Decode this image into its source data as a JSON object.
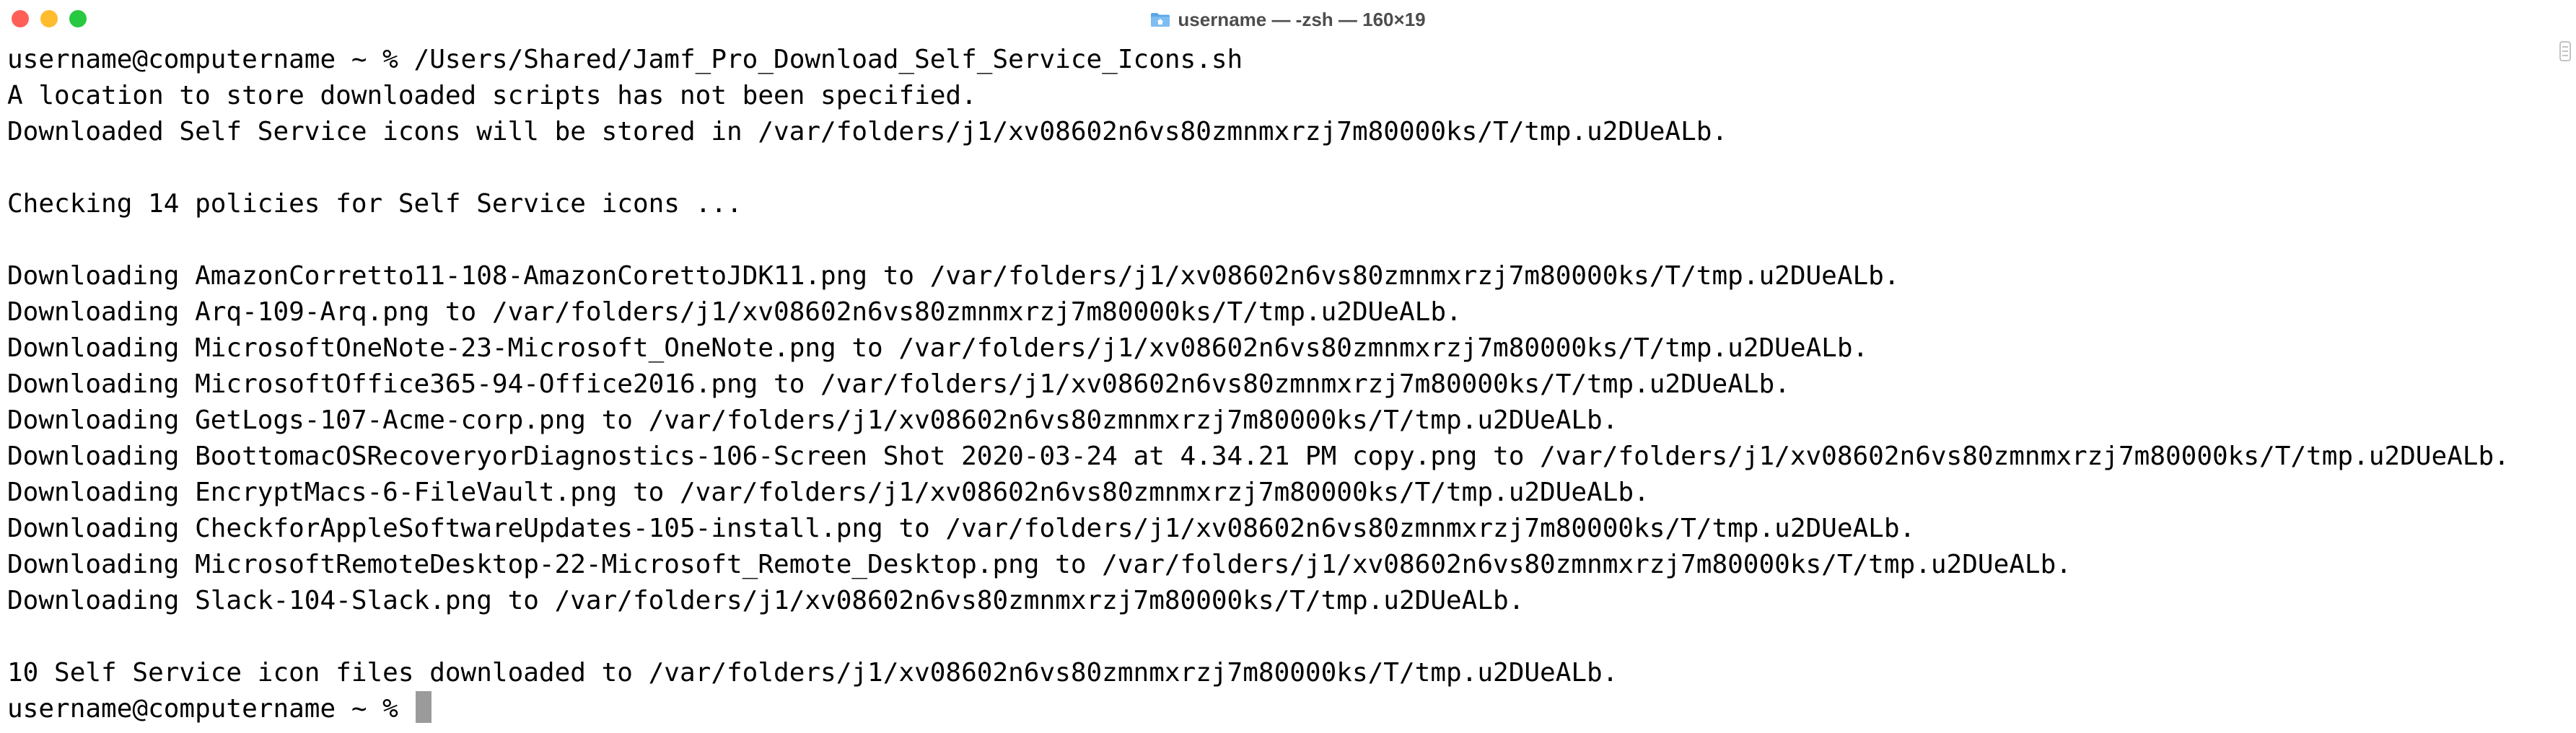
{
  "window": {
    "title": "username — -zsh — 160×19"
  },
  "terminal": {
    "lines": [
      "username@computername ~ % /Users/Shared/Jamf_Pro_Download_Self_Service_Icons.sh",
      "A location to store downloaded scripts has not been specified.",
      "Downloaded Self Service icons will be stored in /var/folders/j1/xv08602n6vs80zmnmxrzj7m80000ks/T/tmp.u2DUeALb.",
      "",
      "Checking 14 policies for Self Service icons ...",
      "",
      "Downloading AmazonCorretto11-108-AmazonCorettoJDK11.png to /var/folders/j1/xv08602n6vs80zmnmxrzj7m80000ks/T/tmp.u2DUeALb.",
      "Downloading Arq-109-Arq.png to /var/folders/j1/xv08602n6vs80zmnmxrzj7m80000ks/T/tmp.u2DUeALb.",
      "Downloading MicrosoftOneNote-23-Microsoft_OneNote.png to /var/folders/j1/xv08602n6vs80zmnmxrzj7m80000ks/T/tmp.u2DUeALb.",
      "Downloading MicrosoftOffice365-94-Office2016.png to /var/folders/j1/xv08602n6vs80zmnmxrzj7m80000ks/T/tmp.u2DUeALb.",
      "Downloading GetLogs-107-Acme-corp.png to /var/folders/j1/xv08602n6vs80zmnmxrzj7m80000ks/T/tmp.u2DUeALb.",
      "Downloading BoottomacOSRecoveryorDiagnostics-106-Screen Shot 2020-03-24 at 4.34.21 PM copy.png to /var/folders/j1/xv08602n6vs80zmnmxrzj7m80000ks/T/tmp.u2DUeALb.",
      "Downloading EncryptMacs-6-FileVault.png to /var/folders/j1/xv08602n6vs80zmnmxrzj7m80000ks/T/tmp.u2DUeALb.",
      "Downloading CheckforAppleSoftwareUpdates-105-install.png to /var/folders/j1/xv08602n6vs80zmnmxrzj7m80000ks/T/tmp.u2DUeALb.",
      "Downloading MicrosoftRemoteDesktop-22-Microsoft_Remote_Desktop.png to /var/folders/j1/xv08602n6vs80zmnmxrzj7m80000ks/T/tmp.u2DUeALb.",
      "Downloading Slack-104-Slack.png to /var/folders/j1/xv08602n6vs80zmnmxrzj7m80000ks/T/tmp.u2DUeALb.",
      "",
      "10 Self Service icon files downloaded to /var/folders/j1/xv08602n6vs80zmnmxrzj7m80000ks/T/tmp.u2DUeALb."
    ],
    "prompt": "username@computername ~ % "
  }
}
